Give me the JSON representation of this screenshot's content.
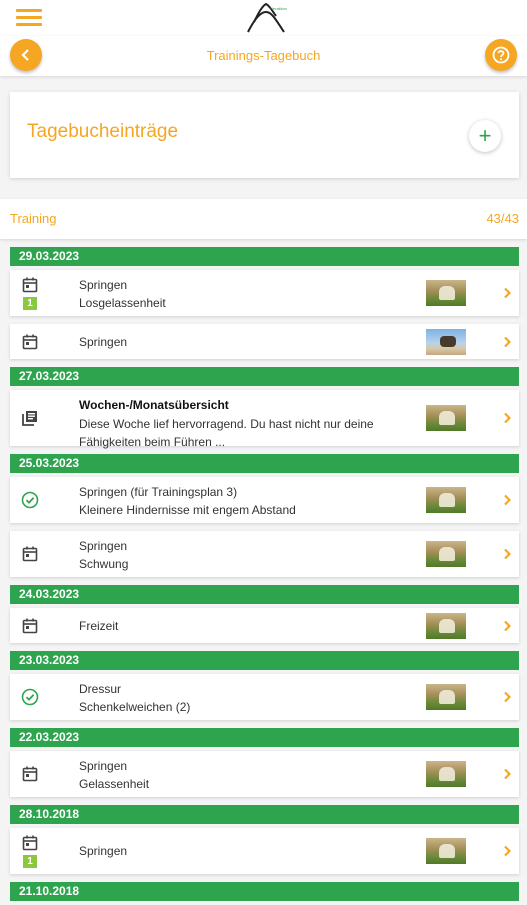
{
  "nav": {
    "title": "Trainings-Tagebuch"
  },
  "entries": {
    "title": "Tagebucheinträge",
    "add_label": "+"
  },
  "section": {
    "label": "Training",
    "count": "43/43"
  },
  "colors": {
    "accent": "#f5a623",
    "date_bar": "#2ea44f",
    "badge": "#8dc63f"
  },
  "groups": [
    {
      "date": "29.03.2023",
      "items": [
        {
          "icon": "calendar-icon",
          "badge": "1",
          "title": "Springen",
          "subtitle": "Losgelassenheit",
          "thumb": "horse-photo"
        },
        {
          "icon": "calendar-icon",
          "title": "Springen",
          "thumb": "horse-jump-photo"
        }
      ]
    },
    {
      "date": "27.03.2023",
      "items": [
        {
          "icon": "summary-icon",
          "title": "Wochen-/Monatsübersicht",
          "subtitle": "Diese Woche lief hervorragend. Du hast nicht nur deine",
          "subtitle2": "Fähigkeiten beim Führen ...",
          "thumb": "horse-photo"
        }
      ]
    },
    {
      "date": "25.03.2023",
      "items": [
        {
          "icon": "check-circle-icon",
          "title": "Springen (für Trainingsplan 3)",
          "subtitle": "Kleinere Hindernisse mit engem Abstand",
          "thumb": "horse-photo"
        },
        {
          "icon": "calendar-icon",
          "title": "Springen",
          "subtitle": "Schwung",
          "thumb": "horse-photo"
        }
      ]
    },
    {
      "date": "24.03.2023",
      "items": [
        {
          "icon": "calendar-icon",
          "title": "Freizeit",
          "thumb": "horse-photo"
        }
      ]
    },
    {
      "date": "23.03.2023",
      "items": [
        {
          "icon": "check-circle-icon",
          "title": "Dressur",
          "subtitle": "Schenkelweichen (2)",
          "thumb": "horse-photo"
        }
      ]
    },
    {
      "date": "22.03.2023",
      "items": [
        {
          "icon": "calendar-icon",
          "title": "Springen",
          "subtitle": "Gelassenheit",
          "thumb": "horse-photo"
        }
      ]
    },
    {
      "date": "28.10.2018",
      "items": [
        {
          "icon": "calendar-icon",
          "badge": "1",
          "title": "Springen",
          "thumb": "horse-photo"
        }
      ]
    },
    {
      "date": "21.10.2018",
      "items": []
    }
  ]
}
